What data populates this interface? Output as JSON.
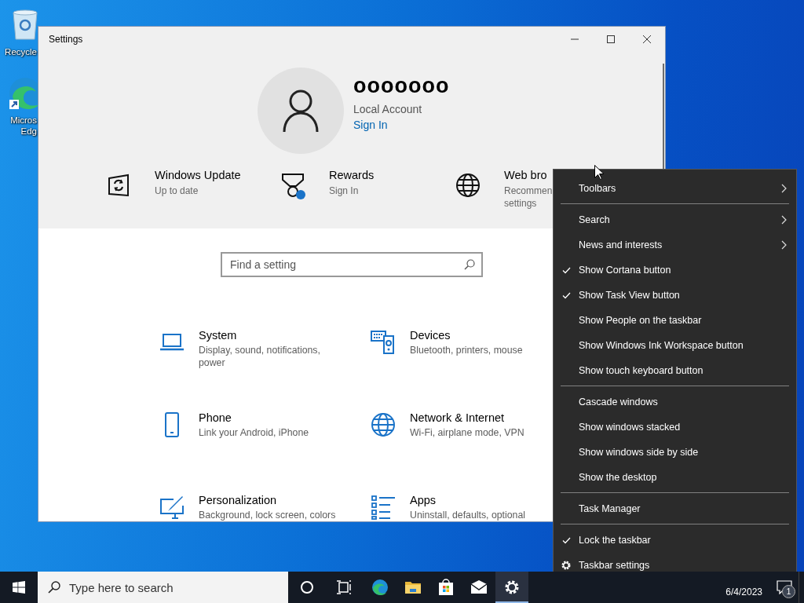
{
  "desktop": {
    "icons": [
      {
        "kind": "recycle-bin",
        "label_lines": [
          "Recycle"
        ]
      },
      {
        "kind": "edge",
        "label_lines": [
          "Micros",
          "Edg"
        ]
      }
    ]
  },
  "settings_window": {
    "title": "Settings",
    "account": {
      "name": "ooooooo",
      "type": "Local Account",
      "link": "Sign In"
    },
    "quick_links": [
      {
        "kind": "update",
        "title": "Windows Update",
        "subtitle_lines": [
          "Up to date"
        ]
      },
      {
        "kind": "rewards",
        "title": "Rewards",
        "subtitle_lines": [
          "Sign In"
        ]
      },
      {
        "kind": "browser",
        "title": "Web bro",
        "subtitle_lines": [
          "Recommen",
          "settings"
        ]
      }
    ],
    "search": {
      "placeholder": "Find a setting"
    },
    "categories": [
      {
        "kind": "system",
        "title": "System",
        "description_lines": [
          "Display, sound, notifications,",
          "power"
        ]
      },
      {
        "kind": "devices",
        "title": "Devices",
        "description_lines": [
          "Bluetooth, printers, mouse"
        ]
      },
      {
        "kind": "phone",
        "title": "Phone",
        "description_lines": [
          "Link your Android, iPhone"
        ]
      },
      {
        "kind": "network",
        "title": "Network & Internet",
        "description_lines": [
          "Wi-Fi, airplane mode, VPN"
        ]
      },
      {
        "kind": "personalization",
        "title": "Personalization",
        "description_lines": [
          "Background, lock screen, colors"
        ]
      },
      {
        "kind": "apps",
        "title": "Apps",
        "description_lines": [
          "Uninstall, defaults, optional"
        ]
      }
    ]
  },
  "context_menu": {
    "groups": [
      [
        {
          "kind": "submenu",
          "label": "Toolbars"
        }
      ],
      [
        {
          "kind": "submenu",
          "label": "Search"
        },
        {
          "kind": "submenu",
          "label": "News and interests"
        },
        {
          "kind": "toggle",
          "label": "Show Cortana button",
          "checked": true
        },
        {
          "kind": "toggle",
          "label": "Show Task View button",
          "checked": true
        },
        {
          "kind": "toggle",
          "label": "Show People on the taskbar",
          "checked": false
        },
        {
          "kind": "toggle",
          "label": "Show Windows Ink Workspace button",
          "checked": false
        },
        {
          "kind": "toggle",
          "label": "Show touch keyboard button",
          "checked": false
        }
      ],
      [
        {
          "kind": "command",
          "label": "Cascade windows"
        },
        {
          "kind": "command",
          "label": "Show windows stacked"
        },
        {
          "kind": "command",
          "label": "Show windows side by side"
        },
        {
          "kind": "command",
          "label": "Show the desktop"
        }
      ],
      [
        {
          "kind": "command",
          "label": "Task Manager"
        }
      ],
      [
        {
          "kind": "toggle",
          "label": "Lock the taskbar",
          "checked": true
        },
        {
          "kind": "settings",
          "label": "Taskbar settings"
        }
      ]
    ]
  },
  "taskbar": {
    "search": {
      "placeholder": "Type here to search"
    },
    "apps": [
      {
        "kind": "cortana",
        "selected": false
      },
      {
        "kind": "task-view",
        "selected": false
      },
      {
        "kind": "edge",
        "selected": false
      },
      {
        "kind": "explorer",
        "selected": false
      },
      {
        "kind": "store",
        "selected": false
      },
      {
        "kind": "mail",
        "selected": false
      },
      {
        "kind": "settings",
        "selected": true
      }
    ],
    "date": "6/4/2023",
    "notification_count": "1"
  }
}
